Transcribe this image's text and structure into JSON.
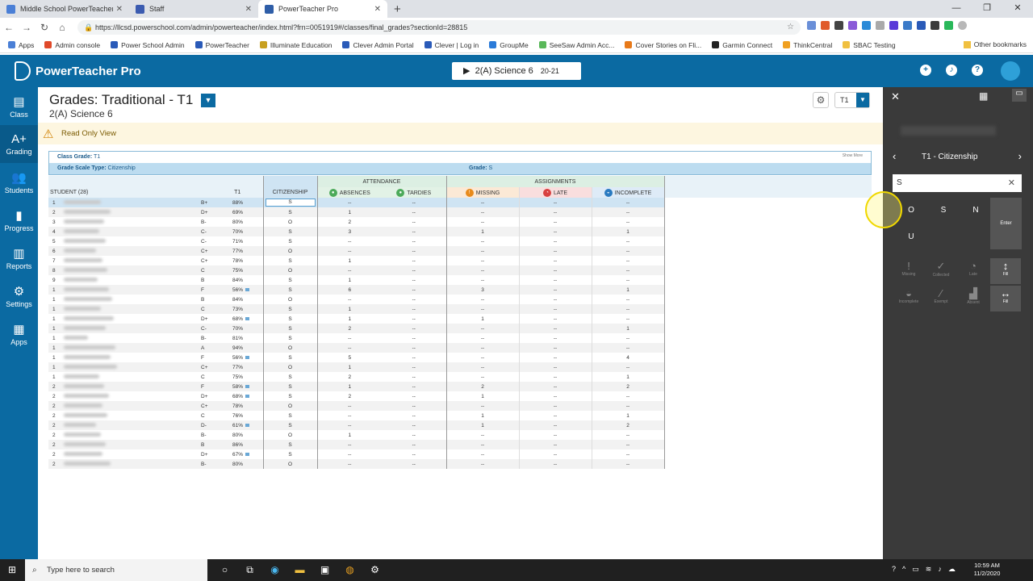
{
  "browser": {
    "tabs": [
      {
        "title": "Middle School PowerTeacher Gra",
        "color": "#4a7fd6",
        "active": false
      },
      {
        "title": "Staff",
        "color": "#3b5bb0",
        "active": false
      },
      {
        "title": "PowerTeacher Pro",
        "color": "#2f5ea8",
        "active": true
      }
    ],
    "url": "https://llcsd.powerschool.com/admin/powerteacher/index.html?frn=0051919#/classes/final_grades?sectionId=28815",
    "bookmarks": [
      "Apps",
      "Admin console",
      "Power School Admin",
      "PowerTeacher",
      "Illuminate Education",
      "Clever Admin Portal",
      "Clever | Log in",
      "GroupMe",
      "SeeSaw Admin Acc...",
      "Cover Stories on Fli...",
      "Garmin Connect",
      "ThinkCentral",
      "SBAC Testing"
    ],
    "other_bookmarks": "Other bookmarks"
  },
  "app": {
    "title": "PowerTeacher Pro",
    "class_selector": "2(A) Science 6",
    "class_term": "20-21"
  },
  "nav": [
    {
      "label": "Class",
      "icon": "class-icon",
      "glyph": "▤"
    },
    {
      "label": "Grading",
      "icon": "grading-icon",
      "glyph": "A+"
    },
    {
      "label": "Students",
      "icon": "students-icon",
      "glyph": "👥"
    },
    {
      "label": "Progress",
      "icon": "progress-icon",
      "glyph": "▮"
    },
    {
      "label": "Reports",
      "icon": "reports-icon",
      "glyph": "▥"
    },
    {
      "label": "Settings",
      "icon": "settings-icon",
      "glyph": "⚙"
    },
    {
      "label": "Apps",
      "icon": "apps-icon",
      "glyph": "▦"
    }
  ],
  "page": {
    "title": "Grades: Traditional - T1",
    "subtitle": "2(A) Science 6",
    "term": "T1",
    "readonly": "Read Only View",
    "class_grade_label": "Class Grade:",
    "class_grade_value": "T1",
    "scale_label": "Grade Scale Type:",
    "scale_value": "Citizenship",
    "grade_label": "Grade:",
    "grade_value": "S",
    "show_more": "Show More"
  },
  "grid": {
    "student_header": "STUDENT (28)",
    "t1_header": "T1",
    "citizenship_header": "CITIZENSHIP",
    "attendance_header": "ATTENDANCE",
    "assignments_header": "ASSIGNMENTS",
    "absences": "ABSENCES",
    "tardies": "TARDIES",
    "missing": "MISSING",
    "late": "LATE",
    "incomplete": "INCOMPLETE",
    "rows": [
      {
        "n": "1",
        "w": 46,
        "g": "B+",
        "p": "88%",
        "c": "S",
        "a": "--",
        "t": "--",
        "m": "--",
        "l": "--",
        "i": "--",
        "tag": false
      },
      {
        "n": "2",
        "w": 58,
        "g": "D+",
        "p": "69%",
        "c": "S",
        "a": "1",
        "t": "--",
        "m": "--",
        "l": "--",
        "i": "--",
        "tag": false
      },
      {
        "n": "3",
        "w": 50,
        "g": "B-",
        "p": "80%",
        "c": "O",
        "a": "2",
        "t": "--",
        "m": "--",
        "l": "--",
        "i": "--",
        "tag": false
      },
      {
        "n": "4",
        "w": 44,
        "g": "C-",
        "p": "70%",
        "c": "S",
        "a": "3",
        "t": "--",
        "m": "1",
        "l": "--",
        "i": "1",
        "tag": false
      },
      {
        "n": "5",
        "w": 52,
        "g": "C-",
        "p": "71%",
        "c": "S",
        "a": "--",
        "t": "--",
        "m": "--",
        "l": "--",
        "i": "--",
        "tag": false
      },
      {
        "n": "6",
        "w": 40,
        "g": "C+",
        "p": "77%",
        "c": "O",
        "a": "--",
        "t": "--",
        "m": "--",
        "l": "--",
        "i": "--",
        "tag": false
      },
      {
        "n": "7",
        "w": 48,
        "g": "C+",
        "p": "78%",
        "c": "S",
        "a": "1",
        "t": "--",
        "m": "--",
        "l": "--",
        "i": "--",
        "tag": false
      },
      {
        "n": "8",
        "w": 54,
        "g": "C",
        "p": "75%",
        "c": "O",
        "a": "--",
        "t": "--",
        "m": "--",
        "l": "--",
        "i": "--",
        "tag": false
      },
      {
        "n": "9",
        "w": 42,
        "g": "B",
        "p": "84%",
        "c": "S",
        "a": "1",
        "t": "--",
        "m": "--",
        "l": "--",
        "i": "--",
        "tag": false
      },
      {
        "n": "1",
        "w": 56,
        "g": "F",
        "p": "56%",
        "c": "S",
        "a": "6",
        "t": "--",
        "m": "3",
        "l": "--",
        "i": "1",
        "tag": true
      },
      {
        "n": "1",
        "w": 60,
        "g": "B",
        "p": "84%",
        "c": "O",
        "a": "--",
        "t": "--",
        "m": "--",
        "l": "--",
        "i": "--",
        "tag": false
      },
      {
        "n": "1",
        "w": 46,
        "g": "C",
        "p": "73%",
        "c": "S",
        "a": "1",
        "t": "--",
        "m": "--",
        "l": "--",
        "i": "--",
        "tag": false
      },
      {
        "n": "1",
        "w": 62,
        "g": "D+",
        "p": "68%",
        "c": "S",
        "a": "1",
        "t": "--",
        "m": "1",
        "l": "--",
        "i": "--",
        "tag": true
      },
      {
        "n": "1",
        "w": 52,
        "g": "C-",
        "p": "70%",
        "c": "S",
        "a": "2",
        "t": "--",
        "m": "--",
        "l": "--",
        "i": "1",
        "tag": false
      },
      {
        "n": "1",
        "w": 30,
        "g": "B-",
        "p": "81%",
        "c": "S",
        "a": "--",
        "t": "--",
        "m": "--",
        "l": "--",
        "i": "--",
        "tag": false
      },
      {
        "n": "1",
        "w": 64,
        "g": "A",
        "p": "94%",
        "c": "O",
        "a": "--",
        "t": "--",
        "m": "--",
        "l": "--",
        "i": "--",
        "tag": false
      },
      {
        "n": "1",
        "w": 58,
        "g": "F",
        "p": "56%",
        "c": "S",
        "a": "5",
        "t": "--",
        "m": "--",
        "l": "--",
        "i": "4",
        "tag": true
      },
      {
        "n": "1",
        "w": 66,
        "g": "C+",
        "p": "77%",
        "c": "O",
        "a": "1",
        "t": "--",
        "m": "--",
        "l": "--",
        "i": "--",
        "tag": false
      },
      {
        "n": "1",
        "w": 44,
        "g": "C",
        "p": "75%",
        "c": "S",
        "a": "2",
        "t": "--",
        "m": "--",
        "l": "--",
        "i": "1",
        "tag": false
      },
      {
        "n": "2",
        "w": 50,
        "g": "F",
        "p": "58%",
        "c": "S",
        "a": "1",
        "t": "--",
        "m": "2",
        "l": "--",
        "i": "2",
        "tag": true
      },
      {
        "n": "2",
        "w": 56,
        "g": "D+",
        "p": "68%",
        "c": "S",
        "a": "2",
        "t": "--",
        "m": "1",
        "l": "--",
        "i": "--",
        "tag": true
      },
      {
        "n": "2",
        "w": 48,
        "g": "C+",
        "p": "78%",
        "c": "O",
        "a": "--",
        "t": "--",
        "m": "--",
        "l": "--",
        "i": "--",
        "tag": false
      },
      {
        "n": "2",
        "w": 54,
        "g": "C",
        "p": "76%",
        "c": "S",
        "a": "--",
        "t": "--",
        "m": "1",
        "l": "--",
        "i": "1",
        "tag": false
      },
      {
        "n": "2",
        "w": 40,
        "g": "D-",
        "p": "61%",
        "c": "S",
        "a": "--",
        "t": "--",
        "m": "1",
        "l": "--",
        "i": "2",
        "tag": true
      },
      {
        "n": "2",
        "w": 46,
        "g": "B-",
        "p": "80%",
        "c": "O",
        "a": "1",
        "t": "--",
        "m": "--",
        "l": "--",
        "i": "--",
        "tag": false
      },
      {
        "n": "2",
        "w": 52,
        "g": "B",
        "p": "86%",
        "c": "S",
        "a": "--",
        "t": "--",
        "m": "--",
        "l": "--",
        "i": "--",
        "tag": false
      },
      {
        "n": "2",
        "w": 48,
        "g": "D+",
        "p": "67%",
        "c": "S",
        "a": "--",
        "t": "--",
        "m": "--",
        "l": "--",
        "i": "--",
        "tag": true
      },
      {
        "n": "2",
        "w": 58,
        "g": "B-",
        "p": "80%",
        "c": "O",
        "a": "--",
        "t": "--",
        "m": "--",
        "l": "--",
        "i": "--",
        "tag": false
      }
    ]
  },
  "panel": {
    "nav_label": "T1 - Citizenship",
    "input_value": "S",
    "keys": [
      "O",
      "S",
      "N",
      "U"
    ],
    "enter": "Enter",
    "tools": [
      {
        "label": "Missing",
        "glyph": "!",
        "on": false
      },
      {
        "label": "Collected",
        "glyph": "✓",
        "on": false
      },
      {
        "label": "Late",
        "glyph": "◔",
        "on": false
      },
      {
        "label": "Fill",
        "glyph": "↕",
        "on": true
      },
      {
        "label": "Incomplete",
        "glyph": "◒",
        "on": false
      },
      {
        "label": "Exempt",
        "glyph": "⁄",
        "on": false
      },
      {
        "label": "Absent",
        "glyph": "▟",
        "on": false
      },
      {
        "label": "Fill",
        "glyph": "↔",
        "on": true
      }
    ]
  },
  "taskbar": {
    "search_placeholder": "Type here to search",
    "time": "10:59 AM",
    "date": "11/2/2020"
  }
}
